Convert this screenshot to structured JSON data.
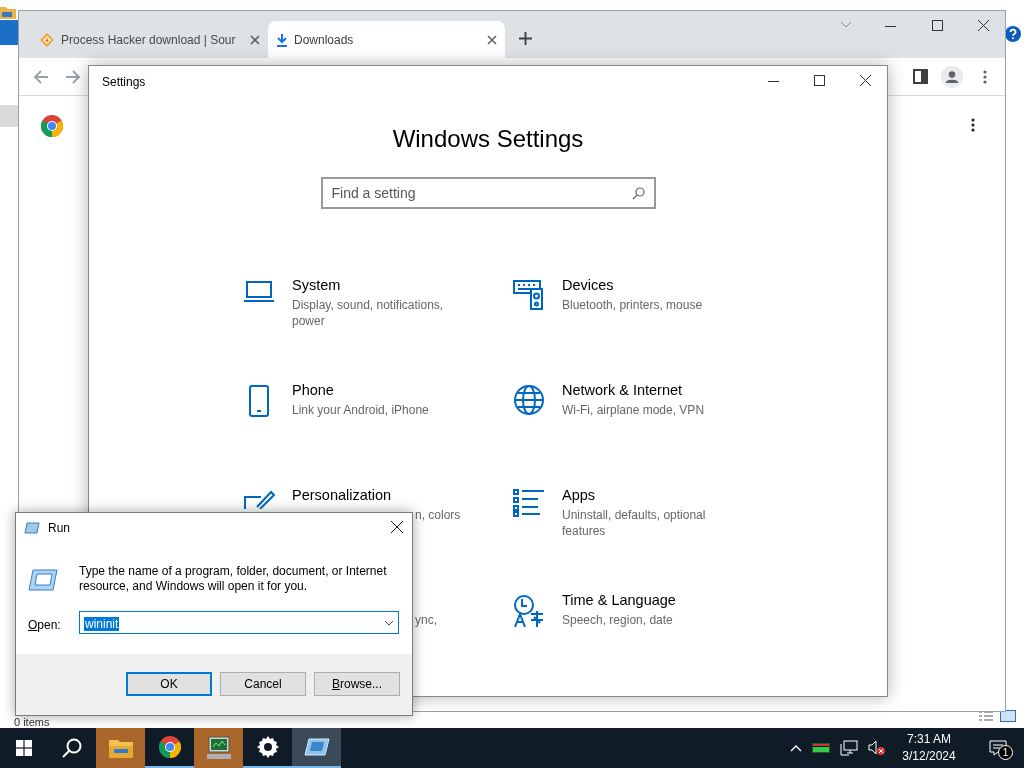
{
  "explorer": {
    "status": "0 items"
  },
  "browser": {
    "tabs": [
      {
        "title": "Process Hacker download | Sour",
        "kind": "web",
        "selected": false
      },
      {
        "title": "Downloads",
        "kind": "downloads",
        "selected": true
      }
    ]
  },
  "settings": {
    "title": "Settings",
    "heading": "Windows Settings",
    "search": {
      "placeholder": "Find a setting"
    },
    "items": [
      {
        "kind": "system",
        "title": "System",
        "description": "Display, sound, notifications, power",
        "clipped": false
      },
      {
        "kind": "devices",
        "title": "Devices",
        "description": "Bluetooth, printers, mouse",
        "clipped": false
      },
      {
        "kind": "phone",
        "title": "Phone",
        "description": "Link your Android, iPhone",
        "clipped": false
      },
      {
        "kind": "network",
        "title": "Network & Internet",
        "description": "Wi-Fi, airplane mode, VPN",
        "clipped": false
      },
      {
        "kind": "personalization",
        "title": "Personalization",
        "description": "n, colors",
        "clipped": true
      },
      {
        "kind": "apps",
        "title": "Apps",
        "description": "Uninstall, defaults, optional features",
        "clipped": false
      },
      {
        "kind": "hidden",
        "description": "ync,",
        "clipped": true
      },
      {
        "kind": "time",
        "title": "Time & Language",
        "description": "Speech, region, date",
        "clipped": false
      }
    ]
  },
  "run": {
    "title": "Run",
    "prompt": "Type the name of a program, folder, document, or Internet resource, and Windows will open it for you.",
    "open_label": "Open:",
    "value": "wininit",
    "buttons": [
      {
        "label": "OK",
        "kind": "default"
      },
      {
        "label": "Cancel",
        "kind": "normal"
      },
      {
        "label": "Browse...",
        "kind": "mnemonic"
      }
    ]
  },
  "taskbar": {
    "apps": [
      {
        "kind": "explorer",
        "highlighted": true,
        "running": false,
        "selected": false
      },
      {
        "kind": "chrome",
        "highlighted": false,
        "running": true,
        "selected": false
      },
      {
        "kind": "monitor",
        "highlighted": true,
        "running": false,
        "selected": false
      },
      {
        "kind": "settings",
        "highlighted": false,
        "running": true,
        "selected": false
      },
      {
        "kind": "run",
        "highlighted": false,
        "running": true,
        "selected": true
      }
    ],
    "time": "7:31 AM",
    "date": "3/12/2024",
    "notifications": "1"
  }
}
